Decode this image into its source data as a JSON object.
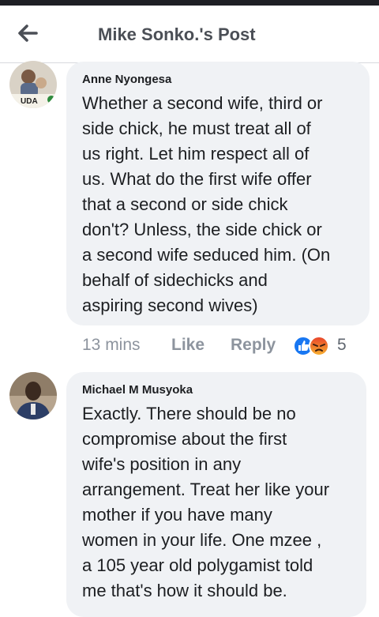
{
  "header": {
    "title": "Mike Sonko.'s Post",
    "back_icon": "arrow-left-icon"
  },
  "comments": [
    {
      "author": "Anne Nyongesa",
      "avatar_badge": "UDA",
      "text": "Whether a second wife, third or\nside chick, he must treat all of\nus right. Let him respect all of\nus. What do the first wife offer\nthat a second or side chick\ndon't? Unless, the side chick or\na second wife seduced him. (On\nbehalf of sidechicks and\naspiring second wives)",
      "time": "13 mins",
      "like_label": "Like",
      "reply_label": "Reply",
      "reactions": [
        "like-icon",
        "angry-icon"
      ],
      "reaction_count": "5"
    },
    {
      "author": "Michael M Musyoka",
      "text": "Exactly. There should be no\ncompromise about the first\nwife's position in any\narrangement. Treat her like your\nmother if you have many\nwomen in your life. One mzee ,\na 105 year old polygamist told\nme that's how it should be."
    }
  ],
  "colors": {
    "bubble": "#f0f2f5",
    "meta_text": "#8d949e",
    "like_blue": "#1877f2",
    "angry_orange": "#f0672b"
  }
}
